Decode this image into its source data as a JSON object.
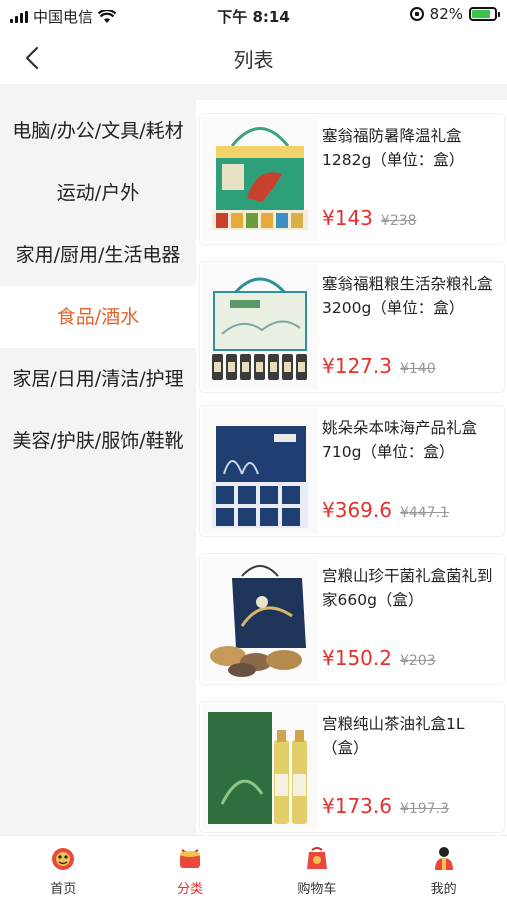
{
  "status": {
    "carrier": "中国电信",
    "time": "下午 8:14",
    "battery": "82%",
    "battery_level": 0.82
  },
  "nav": {
    "title": "列表"
  },
  "categories": [
    {
      "label": "电脑/办公/文具/耗材"
    },
    {
      "label": "运动/户外"
    },
    {
      "label": "家用/厨用/生活电器"
    },
    {
      "label": "食品/酒水",
      "active": true
    },
    {
      "label": "家居/日用/清洁/护理"
    },
    {
      "label": "美容/护肤/服饰/鞋靴"
    }
  ],
  "products": [
    {
      "name": "塞翁福防暑降温礼盒1282g（单位：盒）",
      "price": "¥143",
      "original": "¥238"
    },
    {
      "name": "塞翁福粗粮生活杂粮礼盒3200g（单位：盒）",
      "price": "¥127.3",
      "original": "¥140"
    },
    {
      "name": "姚朵朵本味海产品礼盒710g（单位：盒）",
      "price": "¥369.6",
      "original": "¥447.1"
    },
    {
      "name": "宫粮山珍干菌礼盒菌礼到家660g（盒）",
      "price": "¥150.2",
      "original": "¥203"
    },
    {
      "name": "宫粮纯山茶油礼盒1L（盒）",
      "price": "¥173.6",
      "original": "¥197.3"
    }
  ],
  "tabs": [
    {
      "label": "首页"
    },
    {
      "label": "分类",
      "active": true
    },
    {
      "label": "购物车"
    },
    {
      "label": "我的"
    }
  ],
  "colors": {
    "accent": "#e5622d",
    "price": "#e5302d",
    "battery": "#3bc24a"
  },
  "icons": {
    "back": "chevron-left-icon",
    "home": "lion-head-icon",
    "category": "drum-icon",
    "cart": "bag-icon",
    "mine": "person-icon"
  }
}
